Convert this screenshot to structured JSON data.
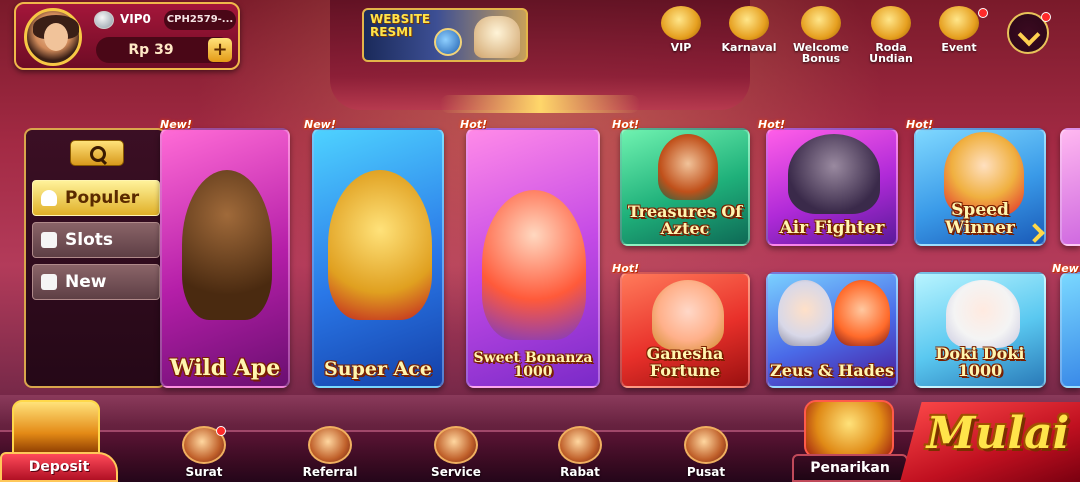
{
  "profile": {
    "vip_level": "VIP0",
    "player_id": "CPH2579-...",
    "balance": "Rp 39",
    "add_label": "+"
  },
  "website_banner": {
    "text": "WEBSITE RESMI"
  },
  "top_menu": [
    {
      "label": "VIP",
      "icon": "crown-icon",
      "badge": false
    },
    {
      "label": "Karnaval",
      "icon": "shield-trophy-icon",
      "badge": false
    },
    {
      "label": "Welcome Bonus",
      "icon": "coin-bag-icon",
      "badge": false
    },
    {
      "label": "Roda Undian",
      "icon": "prize-wheel-icon",
      "badge": false
    },
    {
      "label": "Event",
      "icon": "gift-box-icon",
      "badge": true
    }
  ],
  "sidebar": {
    "search_icon": "search-icon",
    "categories": [
      {
        "label": "Populer",
        "icon": "hand-icon",
        "active": true
      },
      {
        "label": "Slots",
        "icon": "slot-7-icon",
        "active": false
      },
      {
        "label": "New",
        "icon": "new-burst-icon",
        "active": false
      }
    ]
  },
  "games": [
    {
      "title": "Wild Ape",
      "tag": "New!"
    },
    {
      "title": "Super Ace",
      "tag": "New!"
    },
    {
      "title": "Sweet Bonanza 1000",
      "tag": "Hot!"
    },
    {
      "title": "Treasures Of Aztec",
      "tag": "Hot!"
    },
    {
      "title": "Air Fighter",
      "tag": "Hot!"
    },
    {
      "title": "Speed Winner",
      "tag": "Hot!"
    },
    {
      "title": "Ganesha Fortune",
      "tag": "Hot!"
    },
    {
      "title": "Zeus & Hades",
      "tag": ""
    },
    {
      "title": "Doki Doki 1000",
      "tag": ""
    },
    {
      "title": "",
      "tag": "New"
    }
  ],
  "bottom_nav": {
    "deposit": "Deposit",
    "items": [
      {
        "label": "Surat",
        "icon": "mail-icon",
        "badge": true
      },
      {
        "label": "Referral",
        "icon": "handshake-icon",
        "badge": false
      },
      {
        "label": "Service",
        "icon": "headset-icon",
        "badge": false
      },
      {
        "label": "Rabat",
        "icon": "rebate-coin-icon",
        "badge": false
      },
      {
        "label": "Pusat",
        "icon": "document-icon",
        "badge": false
      }
    ],
    "withdraw": "Penarikan",
    "start": "Mulai"
  }
}
